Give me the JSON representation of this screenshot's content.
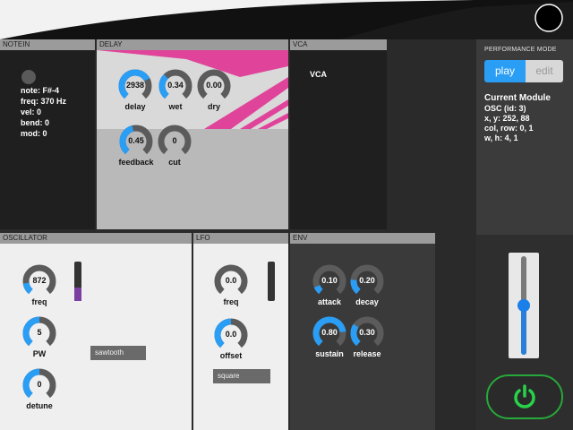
{
  "modules": {
    "notein": {
      "title": "NOTEIN",
      "lines": [
        "note: F#-4",
        "freq: 370 Hz",
        "vel: 0",
        "bend: 0",
        "mod: 0"
      ]
    },
    "delay": {
      "title": "DELAY",
      "knobs": [
        {
          "label": "delay",
          "value": "2938",
          "level": 0.72
        },
        {
          "label": "wet",
          "value": "0.34",
          "level": 0.34
        },
        {
          "label": "dry",
          "value": "0.00",
          "level": 0.0
        },
        {
          "label": "feedback",
          "value": "0.45",
          "level": 0.45
        },
        {
          "label": "cut",
          "value": "0",
          "level": 0.0
        }
      ]
    },
    "vca": {
      "title": "VCA",
      "label": "VCA"
    },
    "oscillator": {
      "title": "OSCILLATOR",
      "knobs": [
        {
          "label": "freq",
          "value": "872",
          "level": 0.15
        },
        {
          "label": "PW",
          "value": "5",
          "level": 0.5
        },
        {
          "label": "detune",
          "value": "0",
          "level": 0.5
        }
      ],
      "slider_level": 0.35,
      "waveform": "sawtooth"
    },
    "lfo": {
      "title": "LFO",
      "knobs": [
        {
          "label": "freq",
          "value": "0.0",
          "level": 0.0
        },
        {
          "label": "offset",
          "value": "0.0",
          "level": 0.5
        }
      ],
      "slider_level": 0.0,
      "waveform": "square"
    },
    "env": {
      "title": "ENV",
      "knobs": [
        {
          "label": "attack",
          "value": "0.10",
          "level": 0.1
        },
        {
          "label": "decay",
          "value": "0.20",
          "level": 0.2
        },
        {
          "label": "sustain",
          "value": "0.80",
          "level": 0.8
        },
        {
          "label": "release",
          "value": "0.30",
          "level": 0.3
        }
      ]
    }
  },
  "sidebar": {
    "performance_mode_label": "PERFORMANCE MODE",
    "play_label": "play",
    "edit_label": "edit",
    "current_module_title": "Current Module",
    "current_module_lines": [
      "OSC (id: 3)",
      "x, y: 252, 88",
      "col, row: 0, 1",
      "w, h: 4, 1"
    ],
    "master_slider_level": 0.5,
    "power_icon": "power-icon"
  },
  "colors": {
    "accent": "#2a9df4",
    "knob_track": "#5b5b5b",
    "pink": "#e0449a",
    "power": "#27d24a",
    "purple": "#7a3fa0"
  }
}
